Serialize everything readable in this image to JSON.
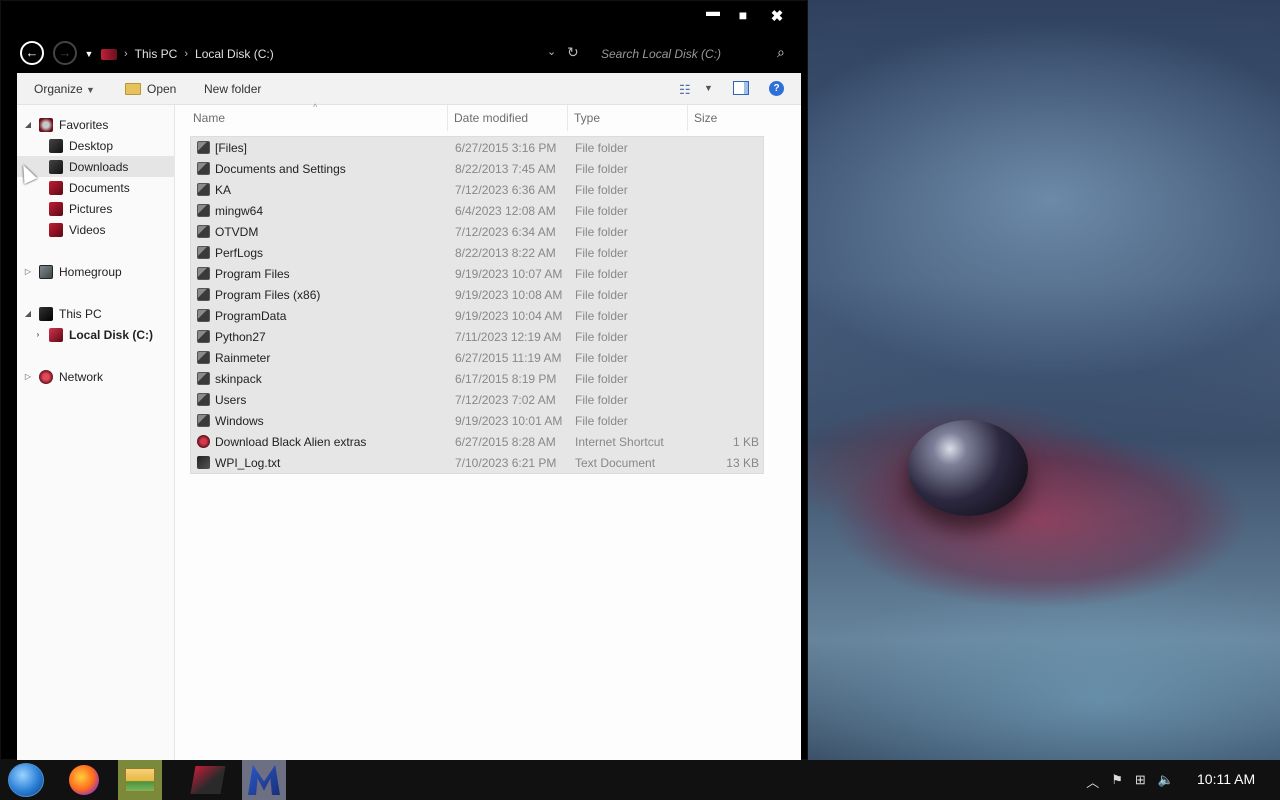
{
  "window": {
    "controls": {
      "minimize": "▬",
      "maximize": "■",
      "close": "✖"
    }
  },
  "address": {
    "breadcrumbs": [
      "This PC",
      "Local Disk (C:)"
    ],
    "search_placeholder": "Search Local Disk (C:)"
  },
  "toolbar": {
    "organize_label": "Organize",
    "open_label": "Open",
    "new_folder_label": "New folder"
  },
  "nav": {
    "favorites": "Favorites",
    "desktop": "Desktop",
    "downloads": "Downloads",
    "documents": "Documents",
    "pictures": "Pictures",
    "videos": "Videos",
    "homegroup": "Homegroup",
    "this_pc": "This PC",
    "local_disk": "Local Disk (C:)",
    "network": "Network"
  },
  "columns": {
    "name": "Name",
    "date": "Date modified",
    "type": "Type",
    "size": "Size"
  },
  "files": [
    {
      "name": "[Files]",
      "date": "6/27/2015 3:16 PM",
      "type": "File folder",
      "size": "",
      "icon": "folder-icon"
    },
    {
      "name": "Documents and Settings",
      "date": "8/22/2013 7:45 AM",
      "type": "File folder",
      "size": "",
      "icon": "folder-icon"
    },
    {
      "name": "KA",
      "date": "7/12/2023 6:36 AM",
      "type": "File folder",
      "size": "",
      "icon": "folder-icon"
    },
    {
      "name": "mingw64",
      "date": "6/4/2023 12:08 AM",
      "type": "File folder",
      "size": "",
      "icon": "folder-icon"
    },
    {
      "name": "OTVDM",
      "date": "7/12/2023 6:34 AM",
      "type": "File folder",
      "size": "",
      "icon": "folder-icon"
    },
    {
      "name": "PerfLogs",
      "date": "8/22/2013 8:22 AM",
      "type": "File folder",
      "size": "",
      "icon": "folder-icon"
    },
    {
      "name": "Program Files",
      "date": "9/19/2023 10:07 AM",
      "type": "File folder",
      "size": "",
      "icon": "folder-icon"
    },
    {
      "name": "Program Files (x86)",
      "date": "9/19/2023 10:08 AM",
      "type": "File folder",
      "size": "",
      "icon": "folder-icon"
    },
    {
      "name": "ProgramData",
      "date": "9/19/2023 10:04 AM",
      "type": "File folder",
      "size": "",
      "icon": "folder-icon"
    },
    {
      "name": "Python27",
      "date": "7/11/2023 12:19 AM",
      "type": "File folder",
      "size": "",
      "icon": "folder-icon"
    },
    {
      "name": "Rainmeter",
      "date": "6/27/2015 11:19 AM",
      "type": "File folder",
      "size": "",
      "icon": "folder-icon"
    },
    {
      "name": "skinpack",
      "date": "6/17/2015 8:19 PM",
      "type": "File folder",
      "size": "",
      "icon": "folder-icon"
    },
    {
      "name": "Users",
      "date": "7/12/2023 7:02 AM",
      "type": "File folder",
      "size": "",
      "icon": "folder-icon"
    },
    {
      "name": "Windows",
      "date": "9/19/2023 10:01 AM",
      "type": "File folder",
      "size": "",
      "icon": "folder-icon"
    },
    {
      "name": "Download Black Alien extras",
      "date": "6/27/2015 8:28 AM",
      "type": "Internet Shortcut",
      "size": "1 KB",
      "icon": "shortcut-icon"
    },
    {
      "name": "WPI_Log.txt",
      "date": "7/10/2023 6:21 PM",
      "type": "Text Document",
      "size": "13 KB",
      "icon": "text-file-icon"
    }
  ],
  "taskbar": {
    "clock": "10:11 AM",
    "apps": [
      "firefox-icon",
      "file-explorer-icon",
      "media-player-icon",
      "malwarebytes-icon"
    ]
  }
}
